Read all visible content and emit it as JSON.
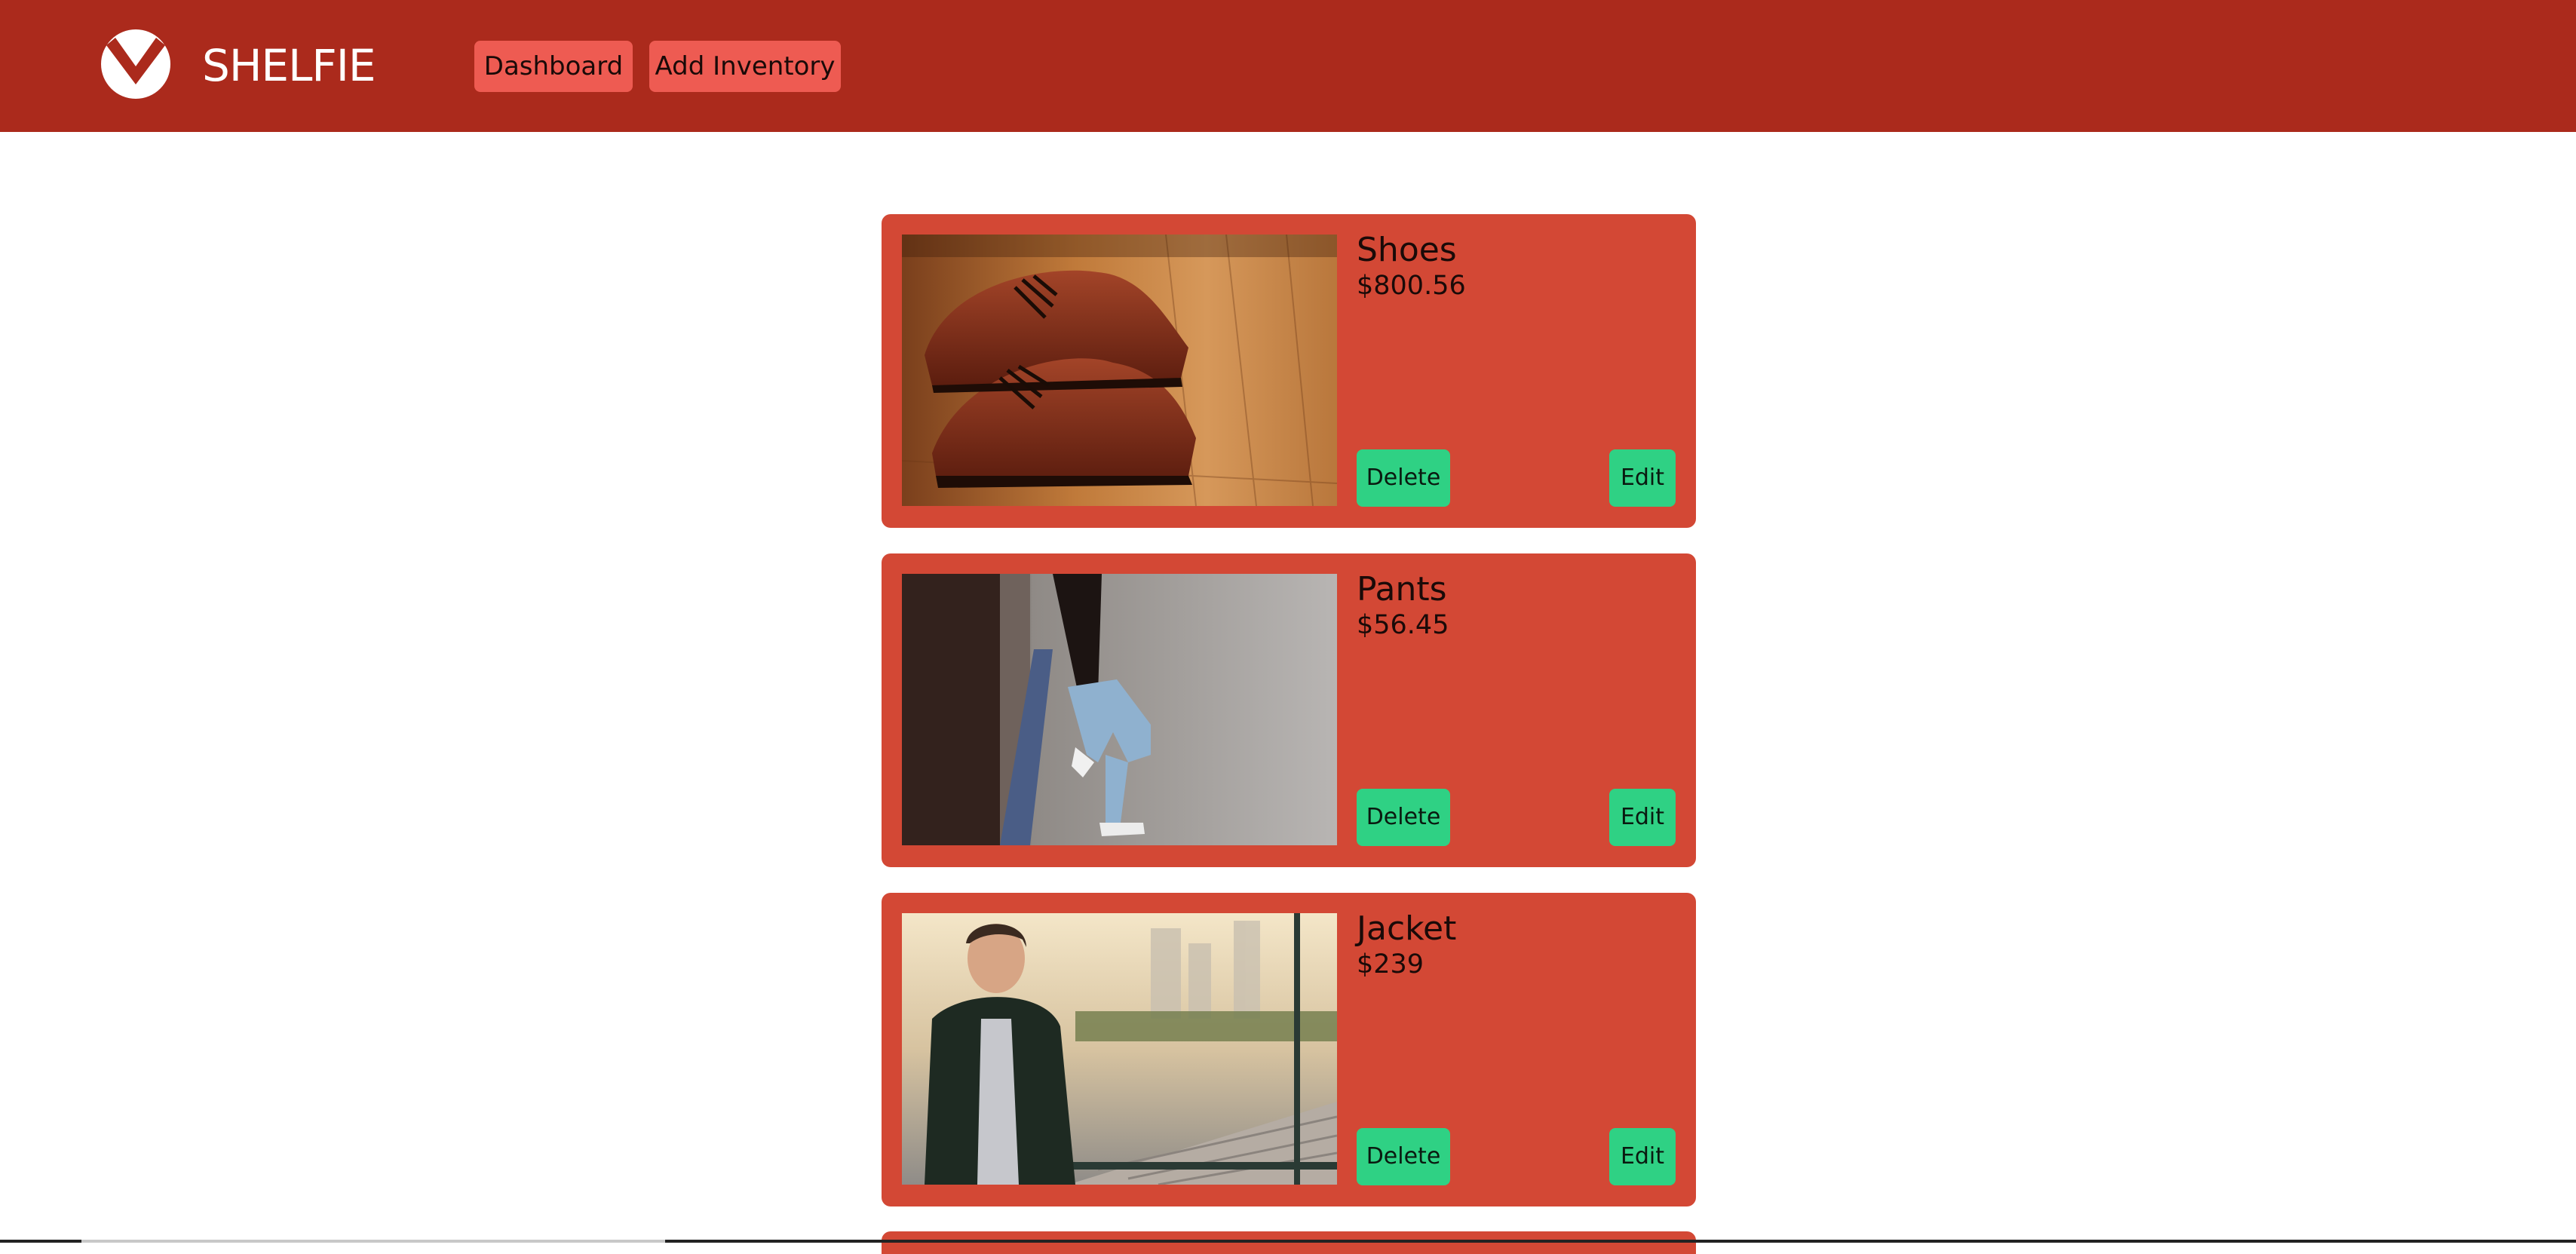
{
  "header": {
    "brand": "SHELFIE",
    "nav": {
      "dashboard_label": "Dashboard",
      "add_inventory_label": "Add Inventory"
    },
    "logo_icon": "checkmark-circle-icon",
    "colors": {
      "header_bg": "#ab2a1c",
      "nav_button_bg": "#ee5b52"
    }
  },
  "inventory": {
    "items": [
      {
        "name": "Shoes",
        "price": "$800.56",
        "image": "brown-leather-shoes-photo",
        "delete_label": "Delete",
        "edit_label": "Edit"
      },
      {
        "name": "Pants",
        "price": "$56.45",
        "image": "person-in-jeans-photo",
        "delete_label": "Delete",
        "edit_label": "Edit"
      },
      {
        "name": "Jacket",
        "price": "$239",
        "image": "man-in-jacket-photo",
        "delete_label": "Delete",
        "edit_label": "Edit"
      }
    ],
    "colors": {
      "card_bg": "#d34835",
      "action_button_bg": "#2fd184"
    }
  }
}
